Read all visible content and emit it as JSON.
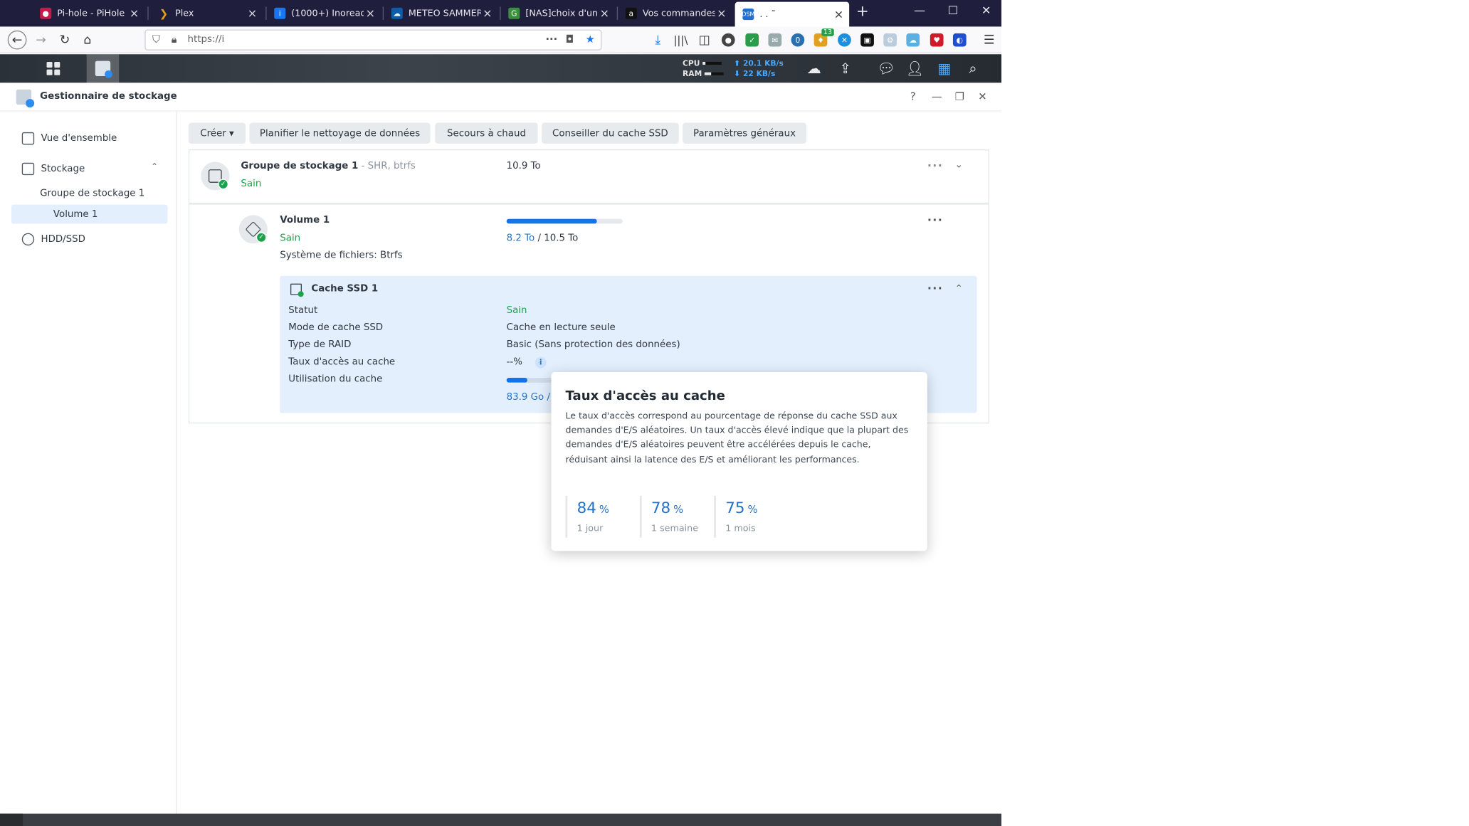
{
  "browser": {
    "tabs": [
      {
        "title": "Pi-hole - PiHole",
        "icon": "raspberry-icon",
        "color": "#c51a4a"
      },
      {
        "title": "Plex",
        "icon": "plex-icon",
        "color": "#e5a00d"
      },
      {
        "title": "(1000+) Inoreader",
        "icon": "inoreader-icon",
        "color": "#1875f3"
      },
      {
        "title": "METEO SAMMERO",
        "icon": "meteo-icon",
        "color": "#0a5ea8"
      },
      {
        "title": "[NAS]choix d'un N",
        "icon": "g-icon",
        "color": "#3b8e3b"
      },
      {
        "title": "Vos commandes",
        "icon": "amazon-icon",
        "color": "#111111"
      },
      {
        "title": ". . ˜",
        "icon": "dsm-icon",
        "color": "#1f6fd1"
      }
    ],
    "url": "https://i",
    "new_tab": "+",
    "win_minimize": "—",
    "win_maximize": "☐",
    "win_close": "✕",
    "ext_badge": "13"
  },
  "dsm": {
    "cpu_label": "CPU",
    "ram_label": "RAM",
    "cpu_level": 0.15,
    "ram_level": 0.35,
    "upload": "⬆ 20.1 KB/s",
    "download": "⬇ 22 KB/s"
  },
  "app": {
    "title": "Gestionnaire de stockage",
    "help": "?",
    "minimize": "—",
    "restore": "❐",
    "close": "✕"
  },
  "sidebar": {
    "overview": "Vue d'ensemble",
    "storage": "Stockage",
    "pool": "Groupe de stockage 1",
    "volume": "Volume 1",
    "hdd": "HDD/SSD"
  },
  "toolbar": {
    "create": "Créer ▾",
    "schedule": "Planifier le nettoyage de données",
    "hotspare": "Secours à chaud",
    "ssd_advisor": "Conseiller du cache SSD",
    "settings": "Paramètres généraux"
  },
  "pool": {
    "name": "Groupe de stockage 1",
    "detail": " - SHR, btrfs",
    "status": "Sain",
    "size": "10.9 To"
  },
  "volume": {
    "name": "Volume 1",
    "status": "Sain",
    "fs": "Système de fichiers: Btrfs",
    "used": "8.2 To",
    "total": " / 10.5 To",
    "usage_fraction": 0.78
  },
  "cache": {
    "name": "Cache SSD 1",
    "rows": [
      {
        "label": "Statut",
        "value": "Sain"
      },
      {
        "label": "Mode de cache SSD",
        "value": "Cache en lecture seule"
      },
      {
        "label": "Type de RAID",
        "value": "Basic (Sans protection des données)"
      },
      {
        "label": "Taux d'accès au cache",
        "value": "--%"
      },
      {
        "label": "Utilisation du cache",
        "value": "83.9 Go /"
      }
    ],
    "usage_fraction": 0.44
  },
  "popover": {
    "title": "Taux d'accès au cache",
    "body": "Le taux d'accès correspond au pourcentage de réponse du cache SSD aux demandes d'E/S aléatoires. Un taux d'accès élevé indique que la plupart des demandes d'E/S aléatoires peuvent être accélérées depuis le cache, réduisant ainsi la latence des E/S et améliorant les performances.",
    "stats": [
      {
        "value": "84",
        "unit": "%",
        "label": "1 jour"
      },
      {
        "value": "78",
        "unit": "%",
        "label": "1 semaine"
      },
      {
        "value": "75",
        "unit": "%",
        "label": "1 mois"
      }
    ]
  },
  "taskbar": {
    "button": "..."
  }
}
